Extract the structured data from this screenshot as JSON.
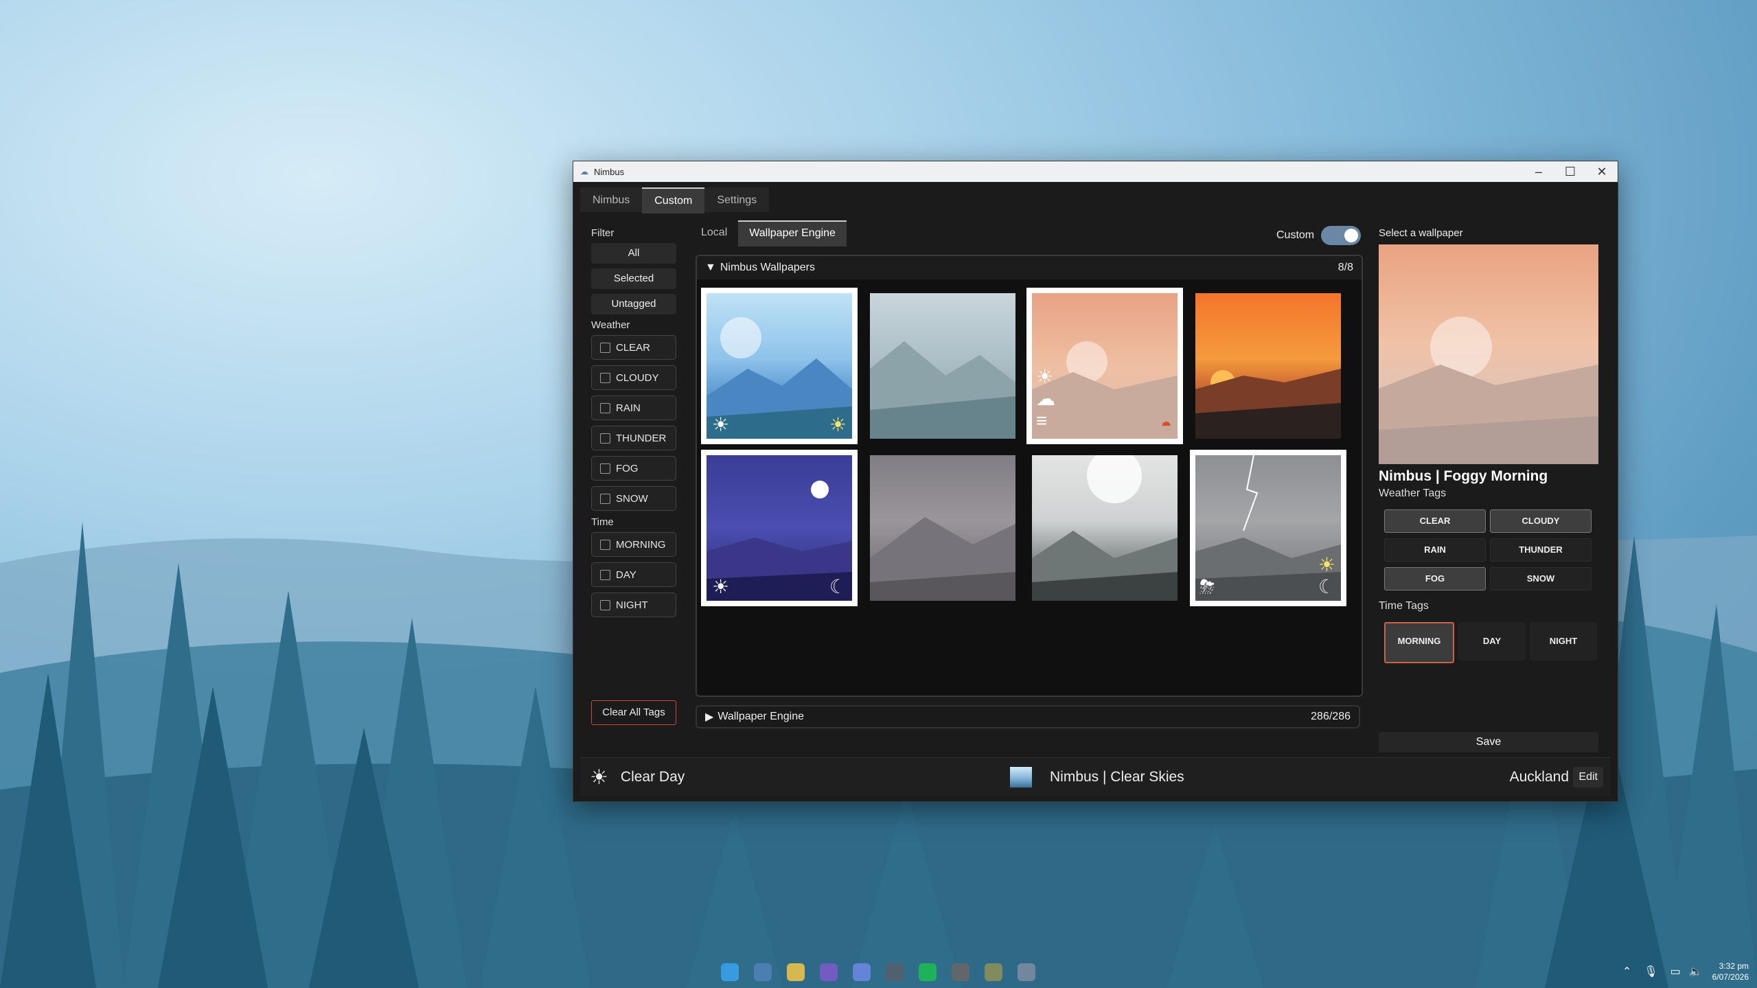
{
  "window": {
    "title": "Nimbus",
    "controls": {
      "minimize": "–",
      "maximize": "☐",
      "close": "✕"
    }
  },
  "tabs": [
    {
      "label": "Nimbus",
      "active": false
    },
    {
      "label": "Custom",
      "active": true
    },
    {
      "label": "Settings",
      "active": false
    }
  ],
  "sidebar": {
    "filter_label": "Filter",
    "filter_buttons": [
      "All",
      "Selected",
      "Untagged"
    ],
    "weather_label": "Weather",
    "weather": [
      "CLEAR",
      "CLOUDY",
      "RAIN",
      "THUNDER",
      "FOG",
      "SNOW"
    ],
    "time_label": "Time",
    "time": [
      "MORNING",
      "DAY",
      "NIGHT"
    ],
    "clear_all": "Clear All Tags"
  },
  "subtabs": [
    {
      "label": "Local",
      "active": false
    },
    {
      "label": "Wallpaper Engine",
      "active": true
    }
  ],
  "custom_toggle": {
    "label": "Custom",
    "on": true
  },
  "gallery": {
    "title": "Nimbus Wallpapers",
    "count": "8/8",
    "thumbnails": [
      {
        "scene": "clear-day",
        "selected": true
      },
      {
        "scene": "cloudy",
        "selected": false
      },
      {
        "scene": "foggy-morning",
        "selected": true
      },
      {
        "scene": "sunset",
        "selected": false
      },
      {
        "scene": "night",
        "selected": true
      },
      {
        "scene": "rain",
        "selected": false
      },
      {
        "scene": "snow",
        "selected": false
      },
      {
        "scene": "thunder",
        "selected": true
      }
    ]
  },
  "wallpaper_engine": {
    "title": "Wallpaper Engine",
    "count": "286/286"
  },
  "right_panel": {
    "heading": "Select a wallpaper",
    "name": "Nimbus | Foggy Morning",
    "weather_tags_label": "Weather Tags",
    "weather_tags": [
      {
        "label": "CLEAR",
        "on": true
      },
      {
        "label": "CLOUDY",
        "on": true
      },
      {
        "label": "RAIN",
        "on": false
      },
      {
        "label": "THUNDER",
        "on": false
      },
      {
        "label": "FOG",
        "on": true
      },
      {
        "label": "SNOW",
        "on": false
      }
    ],
    "time_tags_label": "Time Tags",
    "time_tags": [
      {
        "label": "MORNING",
        "on": true
      },
      {
        "label": "DAY",
        "on": false
      },
      {
        "label": "NIGHT",
        "on": false
      }
    ],
    "save": "Save"
  },
  "footer": {
    "weather_icon": "sun-icon",
    "weather": "Clear Day",
    "wallpaper": "Nimbus | Clear Skies",
    "city": "Auckland",
    "edit": "Edit"
  },
  "taskbar": {
    "time": "3:32 pm",
    "date": "6/07/2026"
  }
}
